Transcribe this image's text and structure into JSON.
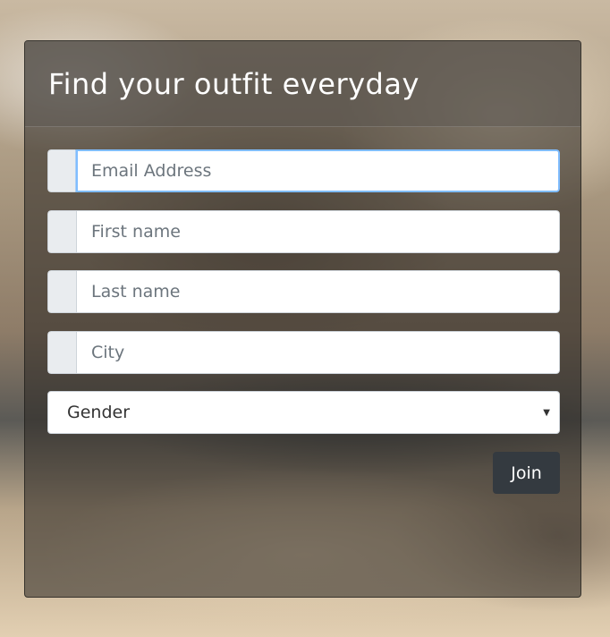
{
  "form": {
    "title": "Find your outfit everyday",
    "fields": {
      "email": {
        "placeholder": "Email Address",
        "value": ""
      },
      "first_name": {
        "placeholder": "First name",
        "value": ""
      },
      "last_name": {
        "placeholder": "Last name",
        "value": ""
      },
      "city": {
        "placeholder": "City",
        "value": ""
      }
    },
    "gender": {
      "selected": "Gender"
    },
    "submit_label": "Join"
  },
  "icons": {
    "select_arrow": "chevron-down-icon"
  },
  "colors": {
    "button_bg": "#343a40",
    "focus_border": "#80bdff",
    "addon_bg": "#e9ecef"
  }
}
